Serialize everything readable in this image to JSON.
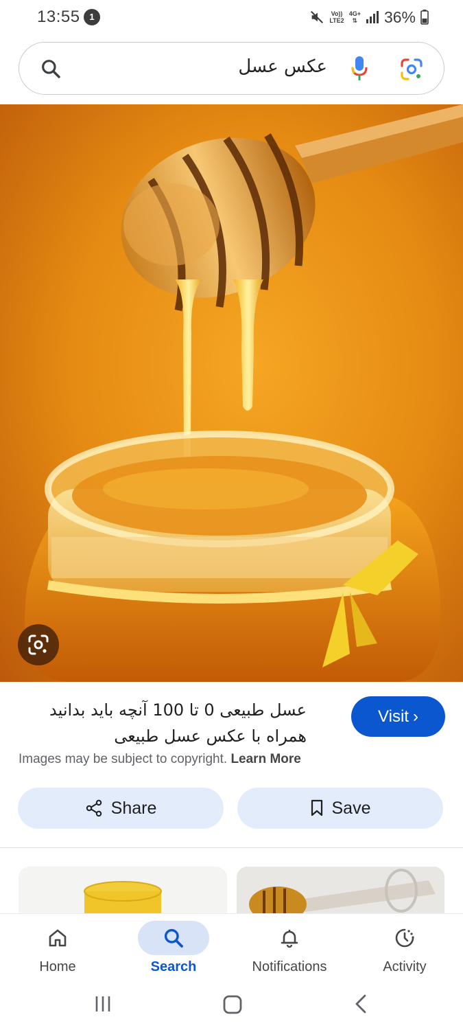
{
  "status_bar": {
    "time": "13:55",
    "notification_count": "1",
    "network_top": "Vo))",
    "network_bottom": "LTE2",
    "data_type": "4G+",
    "battery": "36%"
  },
  "search": {
    "query": "عکس عسل"
  },
  "result": {
    "title": "عسل طبیعی 0 تا 100 آنچه باید بدانید همراه با عکس عسل طبیعی",
    "visit_label": "Visit",
    "copyright_text": "Images may be subject to copyright.",
    "learn_more": "Learn More"
  },
  "actions": {
    "share_label": "Share",
    "save_label": "Save"
  },
  "bottom_nav": {
    "items": [
      {
        "label": "Home",
        "icon": "home-icon"
      },
      {
        "label": "Search",
        "icon": "search-icon",
        "active": true
      },
      {
        "label": "Notifications",
        "icon": "bell-icon"
      },
      {
        "label": "Activity",
        "icon": "activity-icon"
      }
    ]
  },
  "colors": {
    "accent": "#0b57d0",
    "button_tint": "#e3ecfb",
    "honey": "#e88a10"
  }
}
